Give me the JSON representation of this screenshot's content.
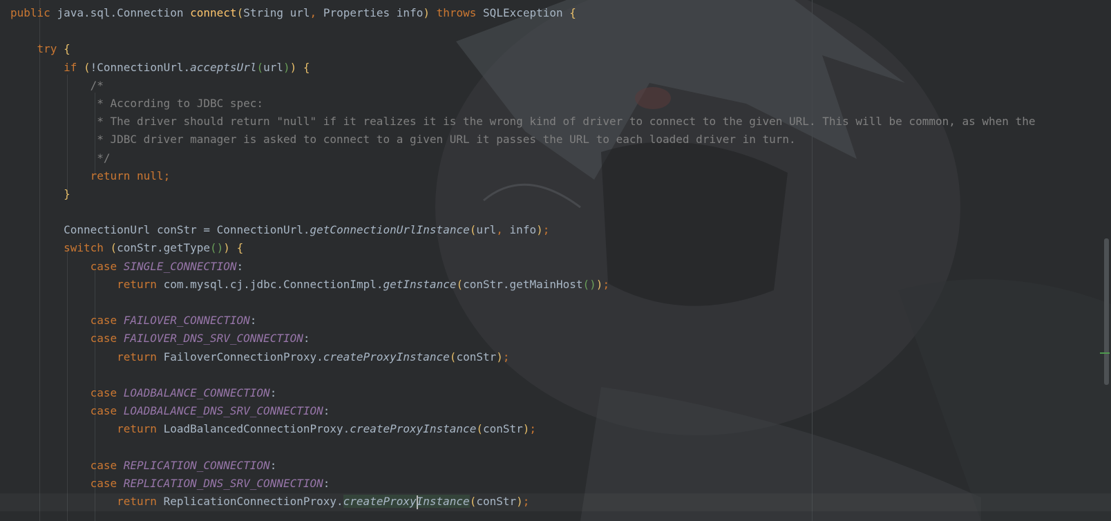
{
  "editor": {
    "language": "java",
    "accent_colors": {
      "keyword": "#cc7832",
      "method": "#ffc66d",
      "constant": "#9876aa",
      "comment": "#808080",
      "text": "#a9b7c6"
    },
    "cursor": {
      "line": 28,
      "after_text": "createProxy"
    },
    "lines": [
      "public java.sql.Connection connect(String url, Properties info) throws SQLException {",
      "",
      "    try {",
      "        if (!ConnectionUrl.acceptsUrl(url)) {",
      "            /*",
      "             * According to JDBC spec:",
      "             * The driver should return \"null\" if it realizes it is the wrong kind of driver to connect to the given URL. This will be common, as when the",
      "             * JDBC driver manager is asked to connect to a given URL it passes the URL to each loaded driver in turn.",
      "             */",
      "            return null;",
      "        }",
      "",
      "        ConnectionUrl conStr = ConnectionUrl.getConnectionUrlInstance(url, info);",
      "        switch (conStr.getType()) {",
      "            case SINGLE_CONNECTION:",
      "                return com.mysql.cj.jdbc.ConnectionImpl.getInstance(conStr.getMainHost());",
      "",
      "            case FAILOVER_CONNECTION:",
      "            case FAILOVER_DNS_SRV_CONNECTION:",
      "                return FailoverConnectionProxy.createProxyInstance(conStr);",
      "",
      "            case LOADBALANCE_CONNECTION:",
      "            case LOADBALANCE_DNS_SRV_CONNECTION:",
      "                return LoadBalancedConnectionProxy.createProxyInstance(conStr);",
      "",
      "            case REPLICATION_CONNECTION:",
      "            case REPLICATION_DNS_SRV_CONNECTION:",
      "                return ReplicationConnectionProxy.createProxyInstance(conStr);"
    ]
  }
}
